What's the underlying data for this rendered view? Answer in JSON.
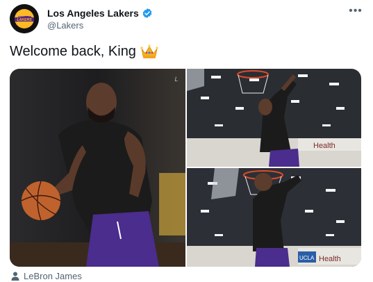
{
  "tweet": {
    "author": {
      "name": "Los Angeles Lakers",
      "handle": "@Lakers",
      "avatar_icon": "lakers-logo",
      "verified": true
    },
    "text": "Welcome back, King",
    "emoji": "crown",
    "media": [
      {
        "description_icon": "player-dribbling-photo"
      },
      {
        "description_icon": "player-dunk-photo"
      },
      {
        "description_icon": "player-dunk-photo"
      }
    ],
    "tagged_user": "LeBron James"
  },
  "colors": {
    "brand_purple": "#552583",
    "brand_gold": "#fdb927",
    "verified_blue": "#1d9bf0",
    "text_secondary": "#536471"
  }
}
